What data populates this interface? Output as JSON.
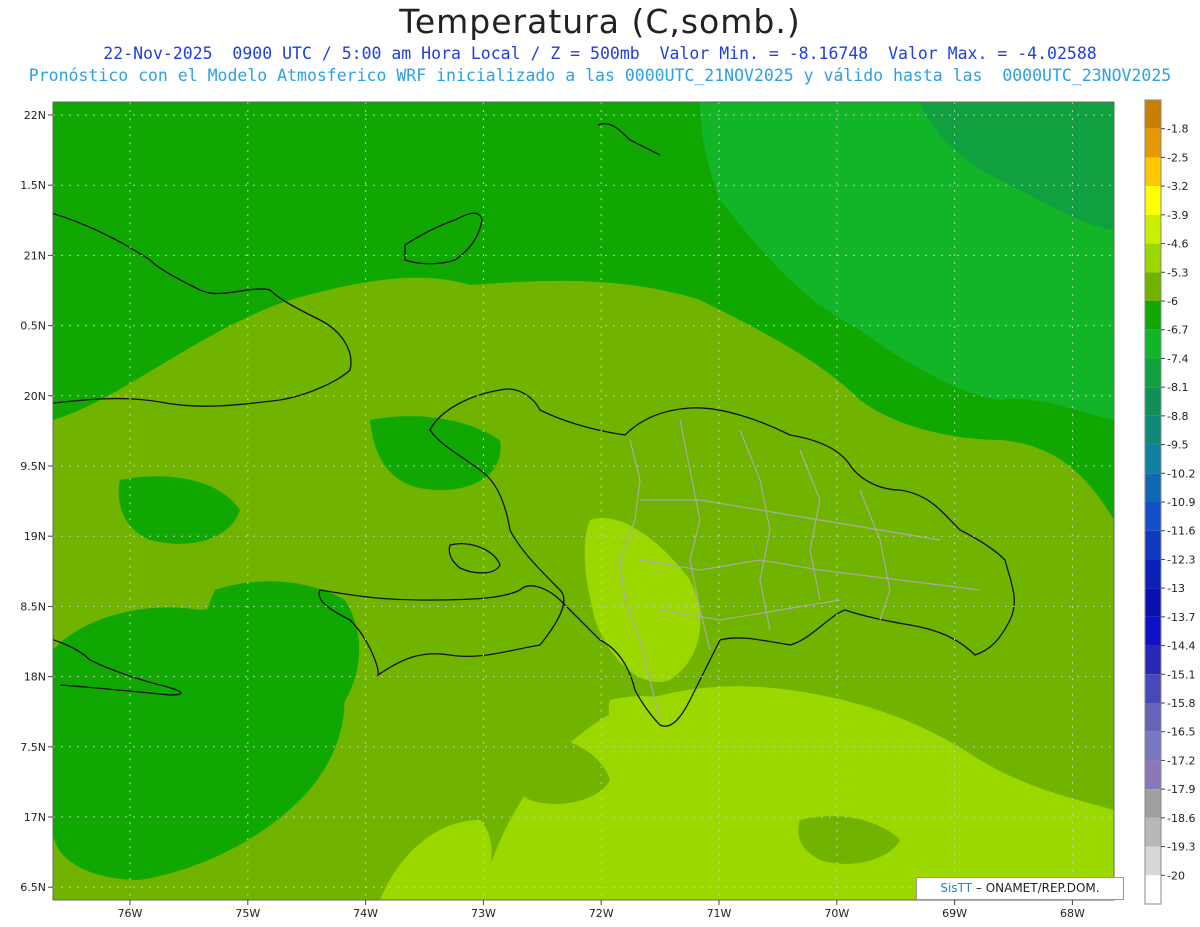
{
  "header": {
    "title": "Temperatura (C,somb.)",
    "subtitle_1": "22-Nov-2025  0900 UTC / 5:00 am Hora Local / Z = 500mb  Valor Min. = -8.16748  Valor Max. = -4.02588",
    "subtitle_2": "Pronóstico con el Modelo Atmosferico WRF inicializado a las 0000UTC_21NOV2025 y válido hasta las  0000UTC_23NOV2025"
  },
  "map": {
    "lat_labels": [
      "22N",
      "1.5N",
      "21N",
      "0.5N",
      "20N",
      "9.5N",
      "19N",
      "8.5N",
      "18N",
      "7.5N",
      "17N",
      "6.5N"
    ],
    "lon_labels": [
      "76W",
      "75W",
      "74W",
      "73W",
      "72W",
      "71W",
      "70W",
      "69W",
      "68W"
    ],
    "grid": true
  },
  "colorbar": {
    "levels": [
      "-1.8",
      "-2.5",
      "-3.2",
      "-3.9",
      "-4.6",
      "-5.3",
      "-6",
      "-6.7",
      "-7.4",
      "-8.1",
      "-8.8",
      "-9.5",
      "-10.2",
      "-10.9",
      "-11.6",
      "-12.3",
      "-13",
      "-13.7",
      "-14.4",
      "-15.1",
      "-15.8",
      "-16.5",
      "-17.2",
      "-17.9",
      "-18.6",
      "-19.3",
      "-20"
    ],
    "colors": [
      "#c88000",
      "#e69800",
      "#ffc800",
      "#ffff00",
      "#c8f000",
      "#9ad800",
      "#70b400",
      "#10a800",
      "#12b428",
      "#10a040",
      "#109058",
      "#108a78",
      "#1080a0",
      "#1068b4",
      "#1250c8",
      "#1238c0",
      "#0c20b8",
      "#0c10b0",
      "#1010c8",
      "#2828b4",
      "#4848b8",
      "#6464b8",
      "#7878c0",
      "#8c78b8",
      "#a0a0a0",
      "#b8b8b8",
      "#d8d8d8",
      "#ffffff"
    ]
  },
  "credit": {
    "brand": "SisTT",
    "org": " – ONAMET/REP.DOM."
  }
}
